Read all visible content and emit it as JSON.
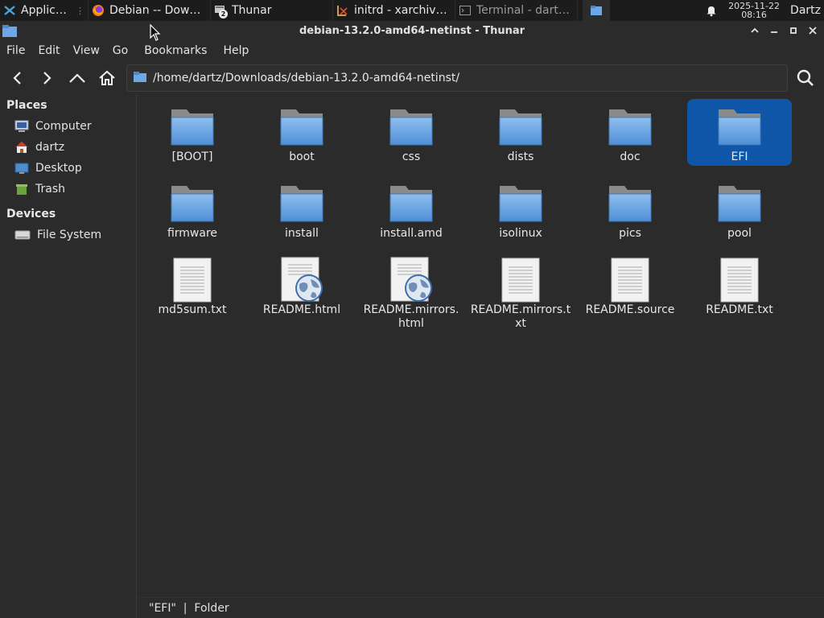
{
  "panel": {
    "applications_label": "Applications",
    "tasks": [
      {
        "label": "Debian -- Downl...",
        "icon": "firefox-icon"
      },
      {
        "label": "Thunar",
        "icon": "thunar-icon",
        "badge": "2"
      },
      {
        "label": "initrd - xarchiver...",
        "icon": "xarchiver-icon"
      },
      {
        "label": "Terminal - dartz...",
        "icon": "terminal-icon"
      }
    ],
    "clock_date": "2025-11-22",
    "clock_time": "08:16",
    "user": "Dartz"
  },
  "window": {
    "title": "debian-13.2.0-amd64-netinst - Thunar",
    "buttons": {
      "shade": "⌃",
      "minimize": "–",
      "maximize": "□",
      "close": "✕"
    }
  },
  "menubar": {
    "items": [
      "File",
      "Edit",
      "View",
      "Go",
      "Bookmarks",
      "Help"
    ]
  },
  "toolbar": {
    "location": "/home/dartz/Downloads/debian-13.2.0-amd64-netinst/"
  },
  "sidebar": {
    "places_heading": "Places",
    "places": [
      {
        "label": "Computer",
        "icon": "computer-icon"
      },
      {
        "label": "dartz",
        "icon": "home-icon"
      },
      {
        "label": "Desktop",
        "icon": "desktop-icon"
      },
      {
        "label": "Trash",
        "icon": "trash-icon"
      }
    ],
    "devices_heading": "Devices",
    "devices": [
      {
        "label": "File System",
        "icon": "drive-icon"
      }
    ]
  },
  "files": [
    {
      "name": "[BOOT]",
      "type": "folder"
    },
    {
      "name": "boot",
      "type": "folder"
    },
    {
      "name": "css",
      "type": "folder"
    },
    {
      "name": "dists",
      "type": "folder"
    },
    {
      "name": "doc",
      "type": "folder"
    },
    {
      "name": "EFI",
      "type": "folder",
      "selected": true
    },
    {
      "name": "firmware",
      "type": "folder"
    },
    {
      "name": "install",
      "type": "folder"
    },
    {
      "name": "install.amd",
      "type": "folder"
    },
    {
      "name": "isolinux",
      "type": "folder"
    },
    {
      "name": "pics",
      "type": "folder"
    },
    {
      "name": "pool",
      "type": "folder"
    },
    {
      "name": "md5sum.txt",
      "type": "text"
    },
    {
      "name": "README.html",
      "type": "html"
    },
    {
      "name": "README.mirrors.html",
      "type": "html"
    },
    {
      "name": "README.mirrors.txt",
      "type": "text"
    },
    {
      "name": "README.source",
      "type": "text"
    },
    {
      "name": "README.txt",
      "type": "text"
    }
  ],
  "status": {
    "text": "\"EFI\"  |  Folder"
  },
  "colors": {
    "selection": "#0f56a8",
    "folder": "#6ea7e6",
    "background": "#2b2b2b"
  }
}
